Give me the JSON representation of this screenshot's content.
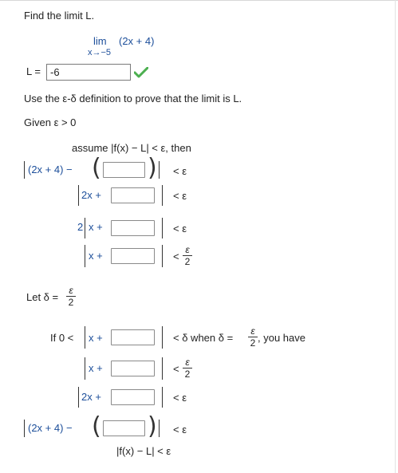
{
  "prompt": "Find the limit L.",
  "limit": {
    "lim": "lim",
    "subscript": "x→−5",
    "expression": "(2x + 4)"
  },
  "answer": {
    "label": "L =",
    "value": "-6",
    "status_color": "#4caf50"
  },
  "instruction": "Use the ε-δ definition to prove that the limit is L.",
  "given": "Given ε > 0",
  "assume": {
    "text": "assume |f(x) − L| < ε, then"
  },
  "rows": {
    "expr": "(2x + 4) −",
    "two_x_plus": "2x +",
    "two": "2",
    "x_plus": "x +",
    "lt_eps": "< ε",
    "lt": "<",
    "eps": "ε",
    "two_den": "2"
  },
  "let_delta": {
    "label": "Let δ =",
    "num": "ε",
    "den": "2"
  },
  "conclusion": {
    "if_zero_lt": "If 0 <",
    "when_delta": "< δ when δ =",
    "you_have": ", you have",
    "final": "|f(x) − L| < ε"
  }
}
